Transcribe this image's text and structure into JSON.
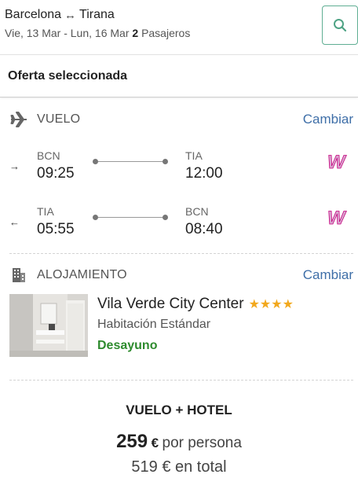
{
  "header": {
    "origin": "Barcelona",
    "swap_symbol": "↔",
    "destination": "Tirana",
    "dates": "Vie, 13 Mar - Lun, 16 Mar",
    "passenger_count": "2",
    "passengers_label": "Pasajeros",
    "search_icon": "search-icon"
  },
  "offer": {
    "title": "Oferta seleccionada"
  },
  "flight": {
    "icon": "airplane-icon",
    "label": "VUELO",
    "change_label": "Cambiar",
    "legs": [
      {
        "direction_symbol": "→",
        "from_code": "BCN",
        "from_time": "09:25",
        "to_code": "TIA",
        "to_time": "12:00",
        "airline_icon": "wizz-air-logo"
      },
      {
        "direction_symbol": "←",
        "from_code": "TIA",
        "from_time": "05:55",
        "to_code": "BCN",
        "to_time": "08:40",
        "airline_icon": "wizz-air-logo"
      }
    ]
  },
  "accommodation": {
    "icon": "building-icon",
    "label": "ALOJAMIENTO",
    "change_label": "Cambiar",
    "hotel_name": "Vila Verde City Center",
    "stars": "★★★★",
    "star_rating": 4,
    "room_type": "Habitación Estándar",
    "board": "Desayuno"
  },
  "price": {
    "title": "VUELO + HOTEL",
    "per_person_amount": "259",
    "currency": "€",
    "per_person_label": "por persona",
    "total": "519 € en total"
  },
  "colors": {
    "link": "#3f6fa8",
    "board_green": "#2e8b2e",
    "star": "#f2a81d",
    "search_border": "#5fae93",
    "airline_pink": "#c6007e"
  }
}
